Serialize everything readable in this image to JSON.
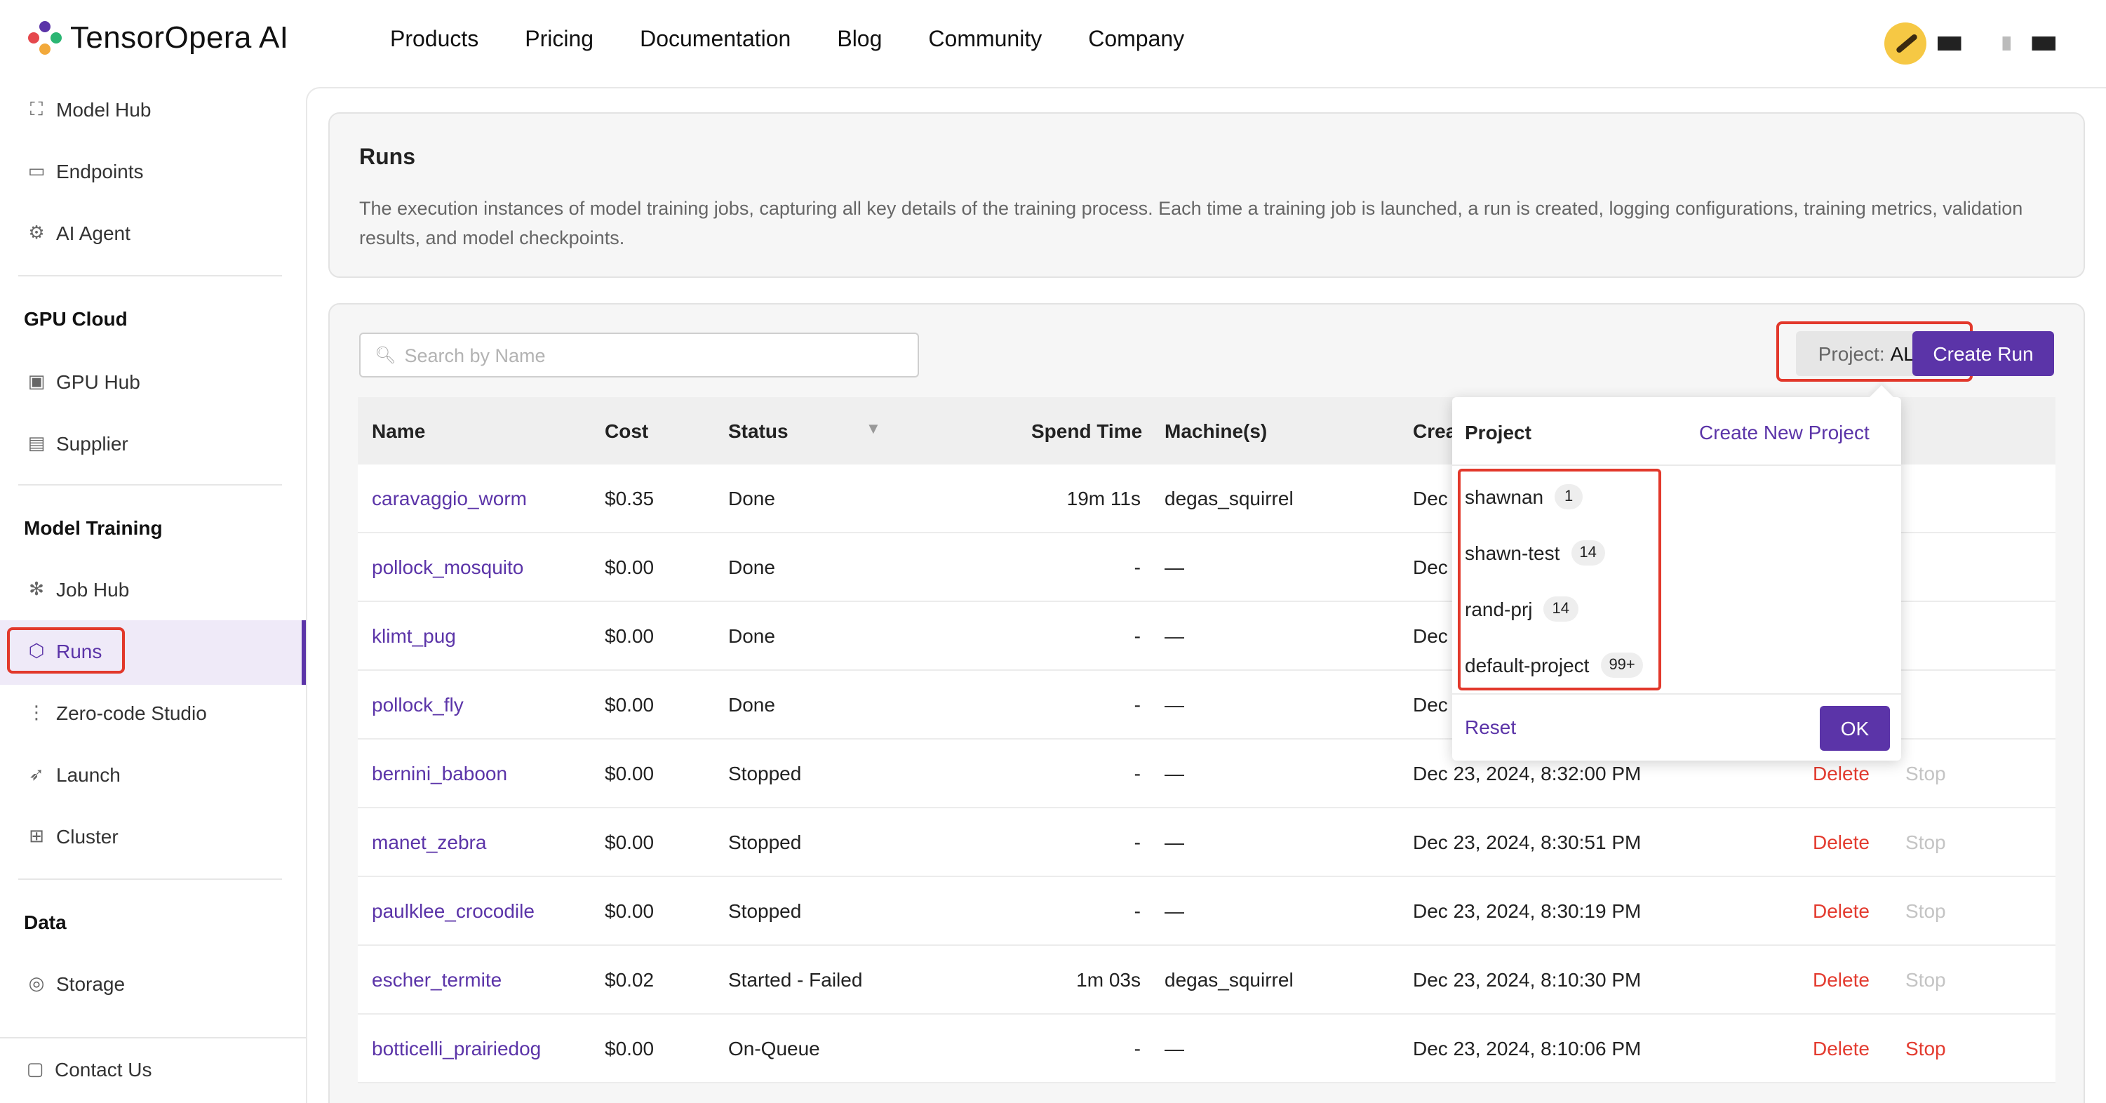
{
  "brand": {
    "name": "TensorOpera AI",
    "logo_colors": [
      "#e5484d",
      "#5b34a8",
      "#f2a93b",
      "#2bb673"
    ]
  },
  "nav": {
    "links": [
      "Products",
      "Pricing",
      "Documentation",
      "Blog",
      "Community",
      "Company"
    ]
  },
  "sidebar": {
    "top_items": [
      {
        "label": "Model Hub",
        "icon": "cube-cluster-icon"
      },
      {
        "label": "Endpoints",
        "icon": "terminal-icon"
      },
      {
        "label": "AI Agent",
        "icon": "robot-icon"
      }
    ],
    "sections": [
      {
        "title": "GPU Cloud",
        "items": [
          {
            "label": "GPU Hub",
            "icon": "gpu-icon"
          },
          {
            "label": "Supplier",
            "icon": "supplier-icon"
          }
        ]
      },
      {
        "title": "Model Training",
        "items": [
          {
            "label": "Job Hub",
            "icon": "network-icon"
          },
          {
            "label": "Runs",
            "icon": "runs-icon",
            "active": true
          },
          {
            "label": "Zero-code Studio",
            "icon": "flow-icon"
          },
          {
            "label": "Launch",
            "icon": "rocket-icon"
          },
          {
            "label": "Cluster",
            "icon": "cluster-icon"
          }
        ]
      },
      {
        "title": "Data",
        "items": [
          {
            "label": "Storage",
            "icon": "database-icon"
          }
        ]
      }
    ],
    "footer_item": {
      "label": "Contact Us",
      "icon": "chat-icon"
    }
  },
  "runs_card": {
    "title": "Runs",
    "description": "The execution instances of model training jobs, capturing all key details of the training process. Each time a training job is launched, a run is created, logging configurations, training metrics, validation results, and model checkpoints."
  },
  "toolbar": {
    "search_placeholder": "Search by Name",
    "project_label": "Project:",
    "project_value": "ALL",
    "create_run_label": "Create Run"
  },
  "table": {
    "columns": [
      "Name",
      "Cost",
      "Status",
      "Spend Time",
      "Machine(s)",
      "Create Tir"
    ],
    "action_delete": "Delete",
    "action_stop": "Stop",
    "rows": [
      {
        "name": "caravaggio_worm",
        "cost": "$0.35",
        "status": "Done",
        "spend": "19m 11s",
        "machine": "degas_squirrel",
        "created": "Dec 23, 20",
        "actions": false,
        "stop_active": false
      },
      {
        "name": "pollock_mosquito",
        "cost": "$0.00",
        "status": "Done",
        "spend": "-",
        "machine": "—",
        "created": "Dec 23, 20",
        "actions": false,
        "stop_active": false
      },
      {
        "name": "klimt_pug",
        "cost": "$0.00",
        "status": "Done",
        "spend": "-",
        "machine": "—",
        "created": "Dec 23, 20",
        "actions": false,
        "stop_active": false
      },
      {
        "name": "pollock_fly",
        "cost": "$0.00",
        "status": "Done",
        "spend": "-",
        "machine": "—",
        "created": "Dec 23, 20",
        "actions": false,
        "stop_active": false
      },
      {
        "name": "bernini_baboon",
        "cost": "$0.00",
        "status": "Stopped",
        "spend": "-",
        "machine": "—",
        "created": "Dec 23, 2024, 8:32:00 PM",
        "actions": true,
        "stop_active": false
      },
      {
        "name": "manet_zebra",
        "cost": "$0.00",
        "status": "Stopped",
        "spend": "-",
        "machine": "—",
        "created": "Dec 23, 2024, 8:30:51 PM",
        "actions": true,
        "stop_active": false
      },
      {
        "name": "paulklee_crocodile",
        "cost": "$0.00",
        "status": "Stopped",
        "spend": "-",
        "machine": "—",
        "created": "Dec 23, 2024, 8:30:19 PM",
        "actions": true,
        "stop_active": false
      },
      {
        "name": "escher_termite",
        "cost": "$0.02",
        "status": "Started - Failed",
        "spend": "1m 03s",
        "machine": "degas_squirrel",
        "created": "Dec 23, 2024, 8:10:30 PM",
        "actions": true,
        "stop_active": false
      },
      {
        "name": "botticelli_prairiedog",
        "cost": "$0.00",
        "status": "On-Queue",
        "spend": "-",
        "machine": "—",
        "created": "Dec 23, 2024, 8:10:06 PM",
        "actions": true,
        "stop_active": true
      }
    ]
  },
  "project_dropdown": {
    "title": "Project",
    "create_label": "Create New Project",
    "items": [
      {
        "name": "shawnan",
        "count": "1"
      },
      {
        "name": "shawn-test",
        "count": "14"
      },
      {
        "name": "rand-prj",
        "count": "14"
      },
      {
        "name": "default-project",
        "count": "99+"
      }
    ],
    "reset_label": "Reset",
    "ok_label": "OK"
  },
  "colors": {
    "accent": "#5b34a8",
    "danger": "#e33b2f",
    "highlight_box": "#e2382b"
  }
}
